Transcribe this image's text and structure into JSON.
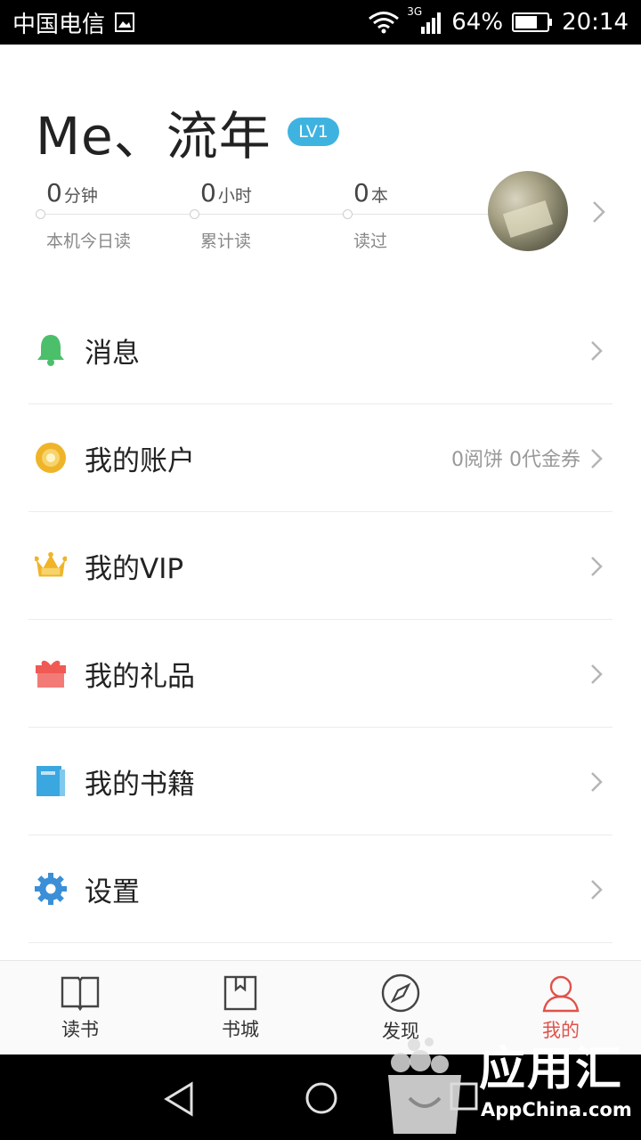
{
  "status_bar": {
    "carrier": "中国电信",
    "network": "3G",
    "battery": "64%",
    "time": "20:14"
  },
  "profile": {
    "username": "Me、流年",
    "level_badge": "LV1",
    "stats": [
      {
        "value": "0",
        "unit": "分钟",
        "label": "本机今日读"
      },
      {
        "value": "0",
        "unit": "小时",
        "label": "累计读"
      },
      {
        "value": "0",
        "unit": "本",
        "label": "读过"
      }
    ]
  },
  "menu": [
    {
      "label": "消息",
      "icon": "bell-icon",
      "extra": ""
    },
    {
      "label": "我的账户",
      "icon": "coin-icon",
      "extra": "0阅饼  0代金券"
    },
    {
      "label": "我的VIP",
      "icon": "crown-icon",
      "extra": ""
    },
    {
      "label": "我的礼品",
      "icon": "gift-icon",
      "extra": ""
    },
    {
      "label": "我的书籍",
      "icon": "book-icon",
      "extra": ""
    },
    {
      "label": "设置",
      "icon": "gear-icon",
      "extra": ""
    }
  ],
  "bottom_nav": [
    {
      "label": "读书",
      "icon": "open-book-icon",
      "active": false
    },
    {
      "label": "书城",
      "icon": "bookmark-book-icon",
      "active": false
    },
    {
      "label": "发现",
      "icon": "compass-icon",
      "active": false
    },
    {
      "label": "我的",
      "icon": "person-icon",
      "active": true
    }
  ],
  "watermark": {
    "title": "应用汇",
    "subtitle": "AppChina.com"
  },
  "colors": {
    "accent_red": "#e0524a",
    "badge_blue": "#3fb3e0",
    "bell_green": "#4cbf6b",
    "coin_gold": "#f0b429",
    "gift_red": "#ef5a55",
    "book_blue": "#3aa7e0",
    "gear_blue": "#3a8fd6"
  }
}
